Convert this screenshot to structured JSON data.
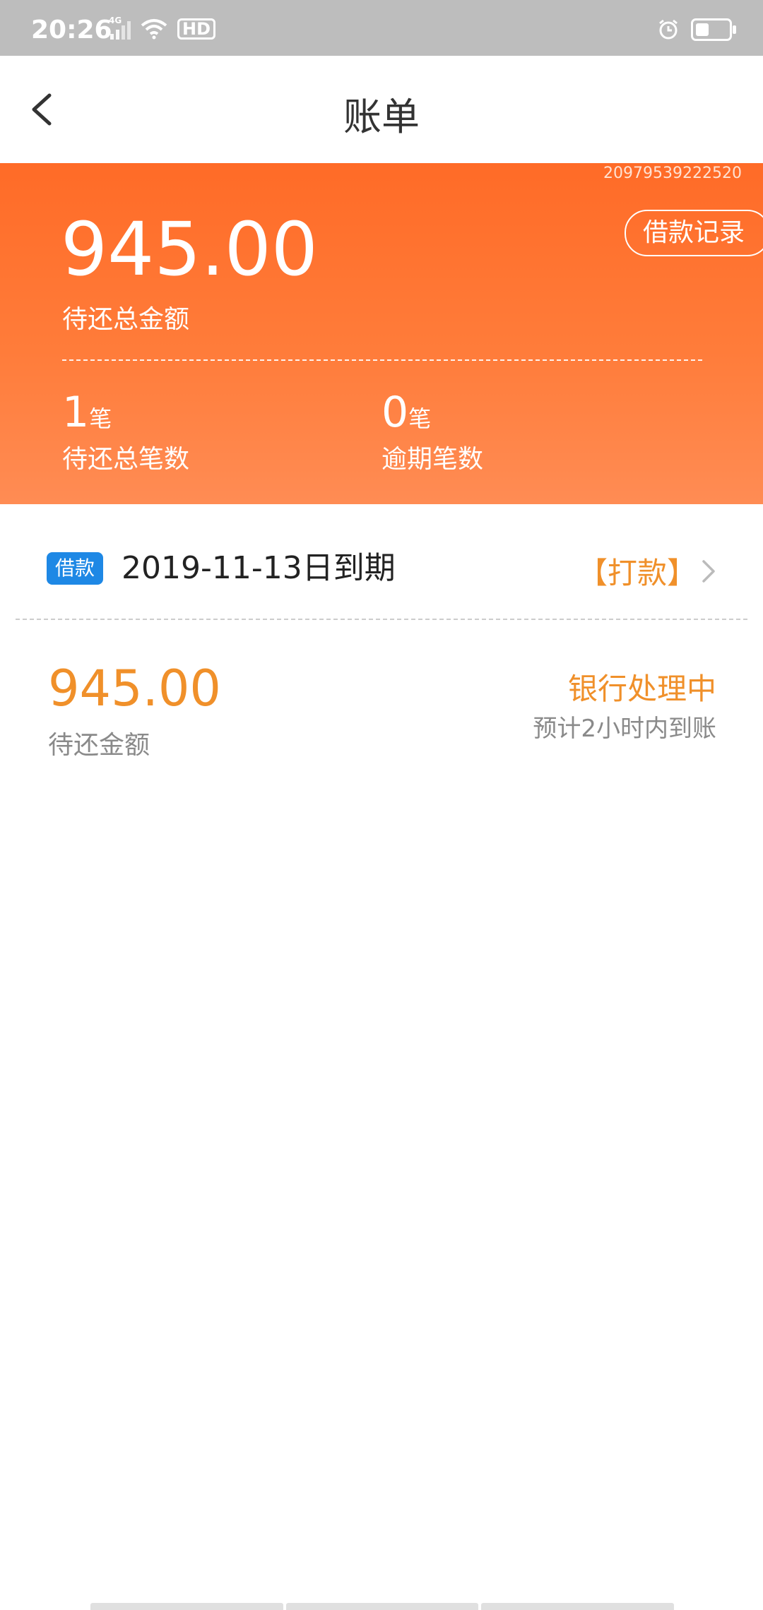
{
  "status_bar": {
    "time": "20:26",
    "network_label": "4G",
    "hd_label": "HD"
  },
  "header": {
    "title": "账单"
  },
  "summary": {
    "order_number": "20979539222520",
    "record_button": "借款记录",
    "total_amount": "945.00",
    "total_label": "待还总金额",
    "pending_count": "1",
    "pending_unit": "笔",
    "pending_label": "待还总笔数",
    "overdue_count": "0",
    "overdue_unit": "笔",
    "overdue_label": "逾期笔数"
  },
  "bill": {
    "tag": "借款",
    "due_date": "2019-11-13日到期",
    "action": "【打款】",
    "amount": "945.00",
    "amount_label": "待还金额",
    "status": "银行处理中",
    "status_note": "预计2小时内到账"
  },
  "colors": {
    "accent_orange": "#ff6b27",
    "amount_orange": "#f0902a",
    "tag_blue": "#1e88e5"
  }
}
